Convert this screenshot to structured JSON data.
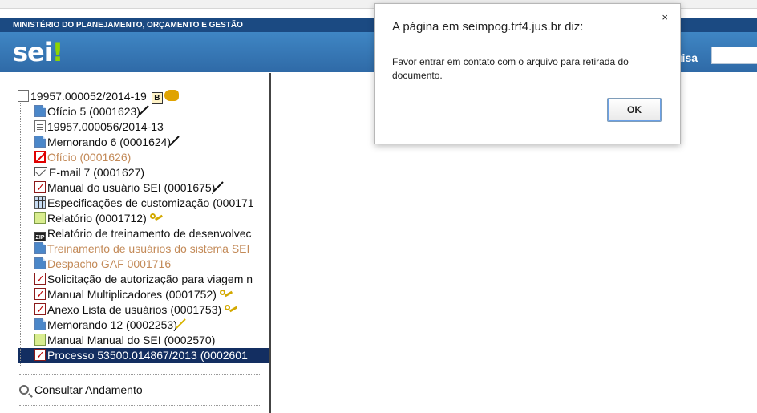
{
  "header": {
    "ministry": "MINISTÉRIO DO PLANEJAMENTO, ORÇAMENTO E GESTÃO",
    "logo": "sei",
    "logo_mark": "!",
    "search_label": "uisa"
  },
  "tree": {
    "root": {
      "label": "19957.000052/2014-19",
      "badge": "B",
      "icon": "document-list-icon"
    },
    "items": [
      {
        "label": "Ofício 5 (0001623)",
        "icon": "document-icon",
        "extra": "pen"
      },
      {
        "label": "19957.000056/2014-13",
        "icon": "linked-process-icon",
        "extra": ""
      },
      {
        "label": "Memorando 6 (0001624)",
        "icon": "document-icon",
        "extra": "pen"
      },
      {
        "label": "Ofício (0001626)",
        "icon": "cancelled-document-icon",
        "extra": ""
      },
      {
        "label": "E-mail 7 (0001627)",
        "icon": "email-icon",
        "extra": ""
      },
      {
        "label": "Manual do usuário SEI (0001675)",
        "icon": "pdf-icon",
        "extra": "pen"
      },
      {
        "label": "Especificações de customização (000171",
        "icon": "spreadsheet-icon",
        "extra": ""
      },
      {
        "label": "Relatório (0001712)",
        "icon": "green-document-icon",
        "extra": "key"
      },
      {
        "label": "Relatório de treinamento de desenvolvec",
        "icon": "zip-icon",
        "extra": ""
      },
      {
        "label": "Treinamento de usuários do sistema SEI",
        "icon": "document-icon",
        "extra": ""
      },
      {
        "label": "Despacho GAF 0001716",
        "icon": "document-icon",
        "extra": ""
      },
      {
        "label": "Solicitação de autorização para viagem n",
        "icon": "pdf-icon",
        "extra": ""
      },
      {
        "label": "Manual Multiplicadores (0001752)",
        "icon": "pdf-icon",
        "extra": "key"
      },
      {
        "label": "Anexo Lista de usuários (0001753)",
        "icon": "pdf-icon",
        "extra": "key"
      },
      {
        "label": "Memorando 12 (0002253)",
        "icon": "document-icon",
        "extra": "yellow-pen"
      },
      {
        "label": "Manual Manual do SEI (0002570)",
        "icon": "green-document-icon",
        "extra": ""
      },
      {
        "label": "Processo 53500.014867/2013 (0002601",
        "icon": "pdf-icon",
        "extra": ""
      }
    ]
  },
  "sidebar": {
    "consult_label": "Consultar Andamento"
  },
  "dialog": {
    "title": "A página em seimpog.trf4.jus.br diz:",
    "close": "×",
    "message": "Favor entrar em contato com o arquivo para retirada do documento.",
    "ok_label": "OK"
  },
  "colors": {
    "header_blue": "#1b4a82",
    "brand_blue": "#3f86c4",
    "selected": "#132e61",
    "muted": "#c38a58"
  }
}
